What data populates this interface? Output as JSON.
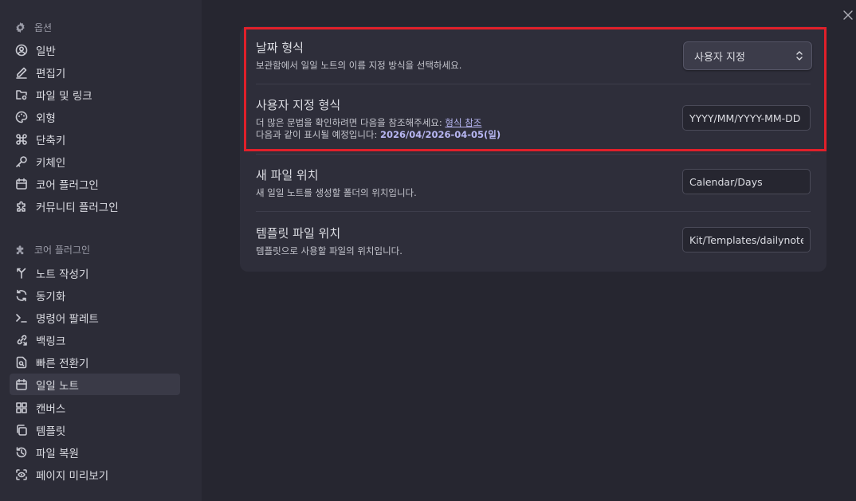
{
  "sidebar": {
    "options_header": "옵션",
    "options_items": [
      {
        "label": "일반",
        "icon": "account-icon"
      },
      {
        "label": "편집기",
        "icon": "pencil-icon"
      },
      {
        "label": "파일 및 링크",
        "icon": "folder-cog-icon"
      },
      {
        "label": "외형",
        "icon": "palette-icon"
      },
      {
        "label": "단축키",
        "icon": "command-icon"
      },
      {
        "label": "키체인",
        "icon": "key-icon"
      },
      {
        "label": "코어 플러그인",
        "icon": "calendar-icon"
      },
      {
        "label": "커뮤니티 플러그인",
        "icon": "puzzle-icon"
      }
    ],
    "core_header": "코어 플러그인",
    "core_items": [
      {
        "label": "노트 작성기",
        "icon": "merge-icon"
      },
      {
        "label": "동기화",
        "icon": "sync-icon"
      },
      {
        "label": "명령어 팔레트",
        "icon": "terminal-icon"
      },
      {
        "label": "백링크",
        "icon": "backlink-icon"
      },
      {
        "label": "빠른 전환기",
        "icon": "file-search-icon"
      },
      {
        "label": "일일 노트",
        "icon": "calendar-icon"
      },
      {
        "label": "캔버스",
        "icon": "layout-icon"
      },
      {
        "label": "템플릿",
        "icon": "copy-icon"
      },
      {
        "label": "파일 복원",
        "icon": "history-icon"
      },
      {
        "label": "페이지 미리보기",
        "icon": "scan-eye-icon"
      }
    ],
    "active_item": "일일 노트"
  },
  "settings": {
    "date_format": {
      "title": "날짜 형식",
      "desc": "보관함에서 일일 노트의 이름 지정 방식을 선택하세요.",
      "value": "사용자 지정"
    },
    "custom_format": {
      "title": "사용자 지정 형식",
      "desc_prefix": "더 많은 문법을 확인하려면 다음을 참조해주세요: ",
      "link": "형식 참조",
      "preview_prefix": "다음과 같이 표시될 예정입니다: ",
      "preview_value": "2026/04/2026-04-05(일)",
      "value": "YYYY/MM/YYYY-MM-DD"
    },
    "new_file_location": {
      "title": "새 파일 위치",
      "desc": "새 일일 노트를 생성할 폴더의 위치입니다.",
      "value": "Calendar/Days"
    },
    "template_location": {
      "title": "템플릿 파일 위치",
      "desc": "템플릿으로 사용할 파일의 위치입니다.",
      "value": "Kit/Templates/dailynote"
    }
  },
  "colors": {
    "accent": "#b7b6f2",
    "highlight": "#e0202a",
    "background": "#262630",
    "sidebar": "#2c2c37"
  }
}
